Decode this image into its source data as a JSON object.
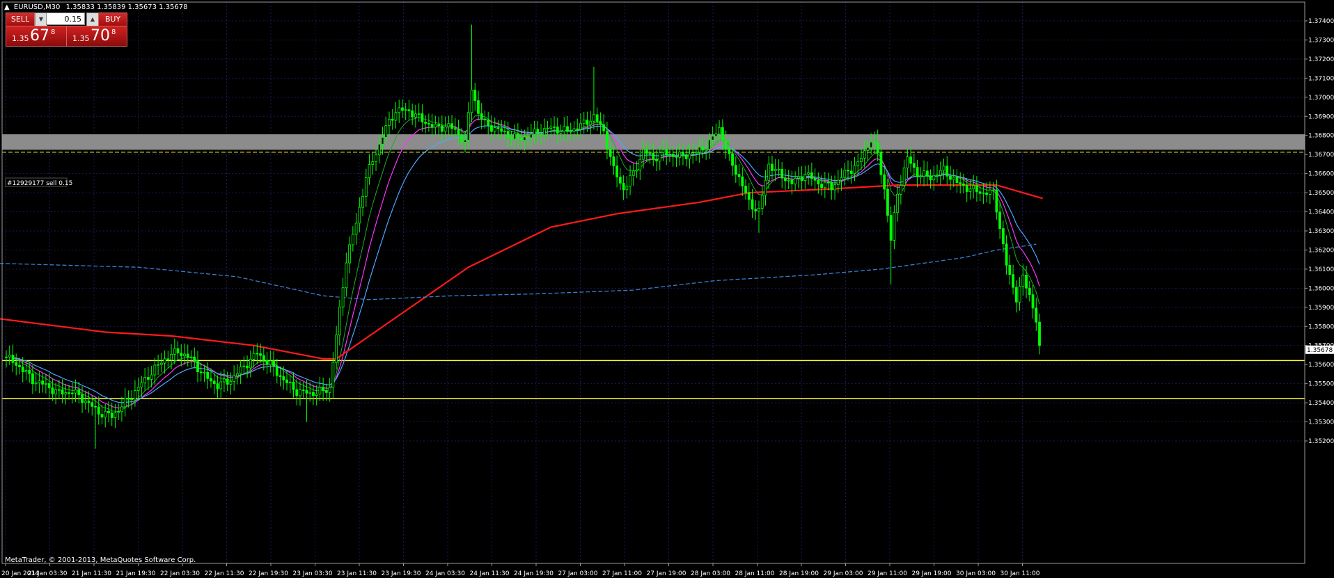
{
  "header": {
    "symbol": "EURUSD,M30",
    "ohlc": "1.35833 1.35839 1.35673 1.35678"
  },
  "trade_panel": {
    "sell_label": "SELL",
    "buy_label": "BUY",
    "lot": "0.15",
    "sell_price_small": "1.35",
    "sell_price_big": "67",
    "sell_price_sup": "8",
    "buy_price_small": "1.35",
    "buy_price_big": "70",
    "buy_price_sup": "8"
  },
  "order_label": "#12929177 sell 0.15",
  "current_price": "1.35678",
  "copyright": "MetaTrader, © 2001-2013, MetaQuotes Software Corp.",
  "colors": {
    "background": "#000000",
    "grid": "#1a1a5a",
    "candle": "#00ff00",
    "ma_red": "#ff1a1a",
    "ma_magenta": "#ff33ff",
    "ma_blue": "#4da6ff",
    "ma_green": "#22aa22",
    "ma_dashed": "#3a7fd0",
    "level_yellow": "#ffff33",
    "zone_gray": "#8c8c8c"
  },
  "chart_data": {
    "type": "candlestick",
    "y_ticks": [
      "1.37400",
      "1.37300",
      "1.37200",
      "1.37100",
      "1.37000",
      "1.36900",
      "1.36800",
      "1.36700",
      "1.36600",
      "1.36500",
      "1.36400",
      "1.36300",
      "1.36200",
      "1.36100",
      "1.36000",
      "1.35900",
      "1.35800",
      "1.35700",
      "1.35600",
      "1.35500",
      "1.35400",
      "1.35300",
      "1.35200"
    ],
    "x_ticks": [
      "20 Jan 2014",
      "21 Jan 03:30",
      "21 Jan 11:30",
      "21 Jan 19:30",
      "22 Jan 03:30",
      "22 Jan 11:30",
      "22 Jan 19:30",
      "23 Jan 03:30",
      "23 Jan 11:30",
      "23 Jan 19:30",
      "24 Jan 03:30",
      "24 Jan 11:30",
      "24 Jan 19:30",
      "27 Jan 03:00",
      "27 Jan 11:00",
      "27 Jan 19:00",
      "28 Jan 03:00",
      "28 Jan 11:00",
      "28 Jan 19:00",
      "29 Jan 03:00",
      "29 Jan 11:00",
      "29 Jan 19:00",
      "30 Jan 03:00",
      "30 Jan 11:00"
    ],
    "ylim": [
      1.3515,
      1.3744
    ],
    "levels": {
      "zone_top": 1.36806,
      "zone_bottom": 1.36725,
      "order_line": 1.36712,
      "support_upper": 1.35621,
      "support_lower": 1.35422
    },
    "close_anchors": [
      [
        0,
        1.3564
      ],
      [
        4,
        1.3559
      ],
      [
        8,
        1.3552
      ],
      [
        12,
        1.3549
      ],
      [
        16,
        1.3545
      ],
      [
        20,
        1.3546
      ],
      [
        24,
        1.3541
      ],
      [
        28,
        1.3535
      ],
      [
        32,
        1.3533
      ],
      [
        36,
        1.354
      ],
      [
        40,
        1.3548
      ],
      [
        44,
        1.3556
      ],
      [
        48,
        1.3563
      ],
      [
        52,
        1.3567
      ],
      [
        56,
        1.3563
      ],
      [
        60,
        1.3554
      ],
      [
        64,
        1.3549
      ],
      [
        68,
        1.3552
      ],
      [
        72,
        1.3559
      ],
      [
        76,
        1.3566
      ],
      [
        80,
        1.356
      ],
      [
        84,
        1.3552
      ],
      [
        88,
        1.3546
      ],
      [
        92,
        1.3545
      ],
      [
        96,
        1.3546
      ],
      [
        98,
        1.3548
      ],
      [
        100,
        1.3575
      ],
      [
        103,
        1.3615
      ],
      [
        106,
        1.3634
      ],
      [
        109,
        1.3658
      ],
      [
        112,
        1.3671
      ],
      [
        115,
        1.3684
      ],
      [
        118,
        1.3693
      ],
      [
        122,
        1.3693
      ],
      [
        126,
        1.3688
      ],
      [
        130,
        1.3684
      ],
      [
        134,
        1.3685
      ],
      [
        137,
        1.3681
      ],
      [
        139,
        1.3676
      ],
      [
        141,
        1.3705
      ],
      [
        143,
        1.3692
      ],
      [
        145,
        1.3686
      ],
      [
        150,
        1.3682
      ],
      [
        155,
        1.3678
      ],
      [
        160,
        1.3681
      ],
      [
        165,
        1.3684
      ],
      [
        170,
        1.3682
      ],
      [
        175,
        1.3686
      ],
      [
        178,
        1.369
      ],
      [
        181,
        1.3682
      ],
      [
        184,
        1.3662
      ],
      [
        187,
        1.3652
      ],
      [
        190,
        1.366
      ],
      [
        193,
        1.3672
      ],
      [
        196,
        1.3668
      ],
      [
        199,
        1.3671
      ],
      [
        204,
        1.3669
      ],
      [
        209,
        1.3671
      ],
      [
        213,
        1.3676
      ],
      [
        216,
        1.3684
      ],
      [
        219,
        1.3668
      ],
      [
        222,
        1.3658
      ],
      [
        225,
        1.3645
      ],
      [
        228,
        1.364
      ],
      [
        231,
        1.3665
      ],
      [
        234,
        1.366
      ],
      [
        238,
        1.3655
      ],
      [
        242,
        1.366
      ],
      [
        246,
        1.3655
      ],
      [
        250,
        1.3653
      ],
      [
        254,
        1.366
      ],
      [
        258,
        1.3665
      ],
      [
        262,
        1.3678
      ],
      [
        264,
        1.367
      ],
      [
        266,
        1.3652
      ],
      [
        268,
        1.3625
      ],
      [
        270,
        1.365
      ],
      [
        273,
        1.3668
      ],
      [
        276,
        1.366
      ],
      [
        280,
        1.3658
      ],
      [
        284,
        1.3662
      ],
      [
        288,
        1.3655
      ],
      [
        292,
        1.3652
      ],
      [
        296,
        1.365
      ],
      [
        299,
        1.365
      ],
      [
        300,
        1.3642
      ],
      [
        303,
        1.3612
      ],
      [
        306,
        1.3595
      ],
      [
        308,
        1.3605
      ],
      [
        310,
        1.3597
      ],
      [
        312,
        1.3583
      ],
      [
        313,
        1.3568
      ]
    ],
    "candle_count": 314,
    "mid_index": 98
  }
}
